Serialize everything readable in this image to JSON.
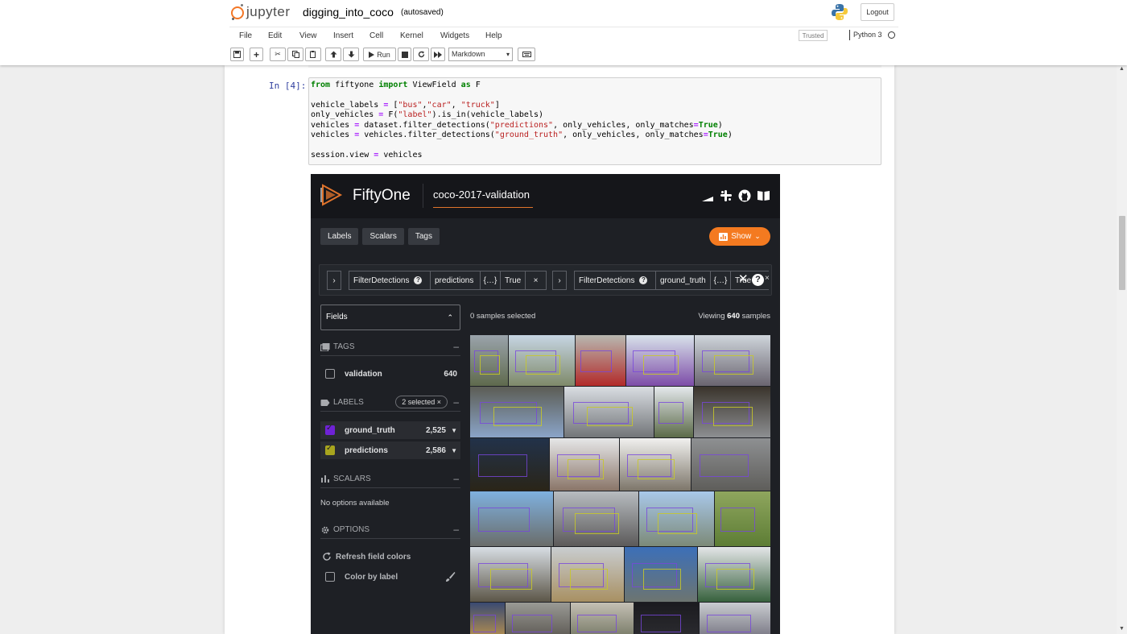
{
  "jupyter": {
    "brand": "jupyter",
    "notebook_name": "digging_into_coco",
    "autosave": "(autosaved)",
    "logout": "Logout",
    "menu": [
      "File",
      "Edit",
      "View",
      "Insert",
      "Cell",
      "Kernel",
      "Widgets",
      "Help"
    ],
    "trusted": "Trusted",
    "kernel": "Python 3",
    "toolbar": {
      "run_label": "Run",
      "cell_type": "Markdown"
    }
  },
  "cell": {
    "prompt": "In [4]:"
  },
  "fiftyone": {
    "brand": "FiftyOne",
    "dataset": "coco-2017-validation",
    "tabs": [
      "Labels",
      "Scalars",
      "Tags"
    ],
    "show_button": "Show",
    "view_stages": [
      {
        "stage": "FilterDetections",
        "field": "predictions",
        "filter": "{…}",
        "only_matches": "True"
      },
      {
        "stage": "FilterDetections",
        "field": "ground_truth",
        "filter": "{…}",
        "only_matches": "True"
      }
    ],
    "fields_label": "Fields",
    "tags": {
      "title": "TAGS",
      "items": [
        {
          "name": "validation",
          "count": "640"
        }
      ]
    },
    "labels": {
      "title": "LABELS",
      "selected": "2 selected ×",
      "items": [
        {
          "name": "ground_truth",
          "count": "2,525",
          "color": "#6f22d6"
        },
        {
          "name": "predictions",
          "count": "2,586",
          "color": "#a8a51e"
        }
      ]
    },
    "scalars": {
      "title": "SCALARS",
      "empty": "No options available"
    },
    "options": {
      "title": "OPTIONS",
      "refresh": "Refresh field colors",
      "color_by_label": "Color by label"
    },
    "samples_selected": "0 samples selected",
    "viewing_prefix": "Viewing",
    "viewing_count": "640",
    "viewing_suffix": "samples",
    "accent_color": "#f47a20"
  }
}
